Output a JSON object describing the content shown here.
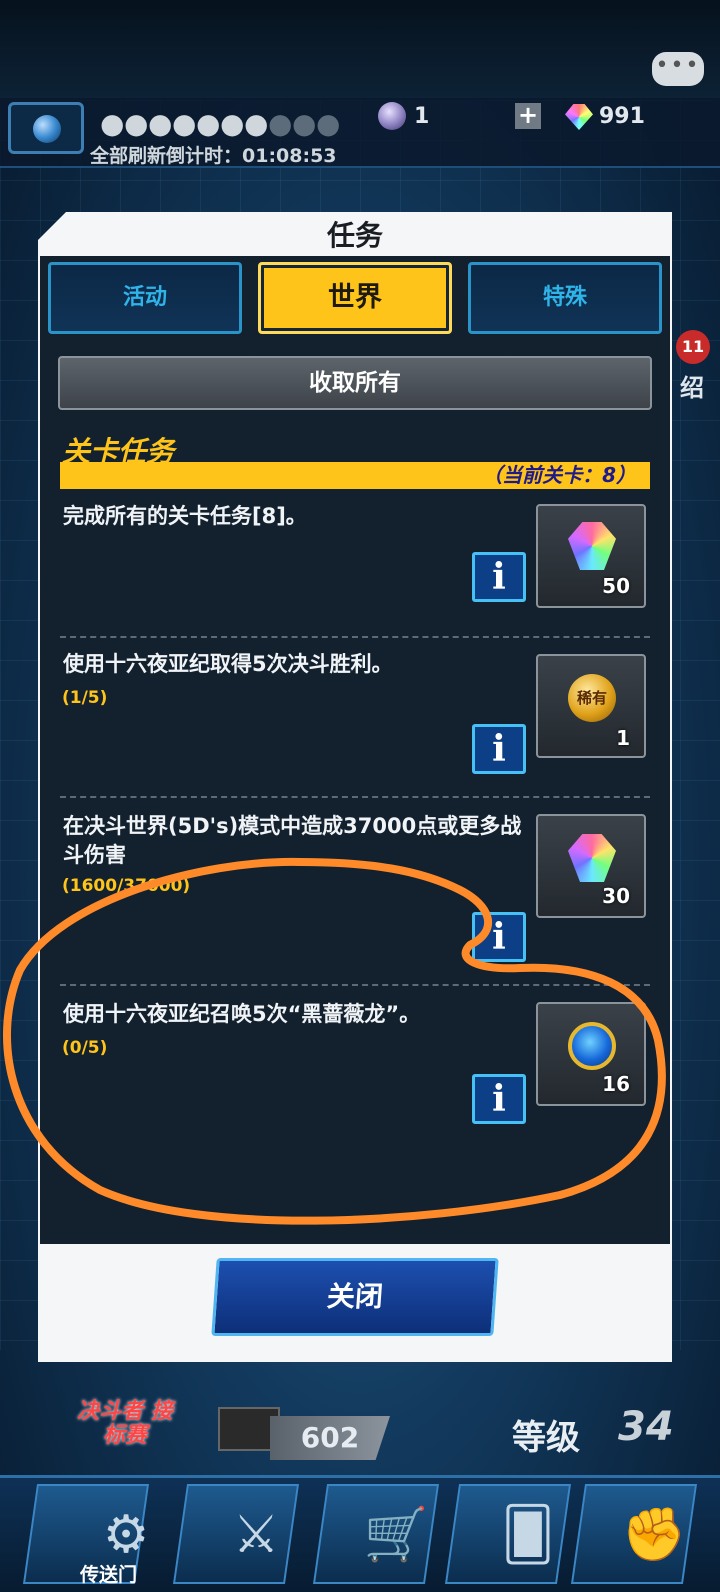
{
  "hud": {
    "refresh_countdown": "全部刷新倒计时：01:08:53",
    "orb_count": "1",
    "gem_count": "991",
    "plus": "+",
    "chat": "•••",
    "side_badge": "11",
    "side_label": "绍"
  },
  "bottom": {
    "logo_text": "决斗者 接标赛",
    "deck_count": "602",
    "level_label": "等级",
    "level_value": "34",
    "portal_label": "传送门"
  },
  "modal": {
    "title": "任务",
    "tabs": [
      {
        "label": "活动"
      },
      {
        "label": "世界"
      },
      {
        "label": "特殊"
      }
    ],
    "active_tab": "世界",
    "collect_all": "收取所有",
    "section_title": "关卡任务",
    "current_stage": "（当前关卡：8）",
    "info_glyph": "i",
    "close_label": "关闭",
    "missions": [
      {
        "text": "完成所有的关卡任务[8]。",
        "progress": "",
        "reward_icon": "rainbow-gem-icon",
        "reward_count": "50"
      },
      {
        "text": "使用十六夜亚纪取得5次决斗胜利。",
        "progress": "(1/5)",
        "reward_icon": "rare-coin-icon",
        "reward_count": "1",
        "reward_badge": "稀有"
      },
      {
        "text": "在决斗世界(5D's)模式中造成37000点或更多战斗伤害",
        "progress": "(1600/37000)",
        "reward_icon": "rainbow-gem-icon",
        "reward_count": "30"
      },
      {
        "text": "使用十六夜亚纪召唤5次“黑蔷薇龙”。",
        "progress": "(0/5)",
        "reward_icon": "blue-key-icon",
        "reward_count": "16"
      }
    ]
  },
  "colors": {
    "accent_gold": "#ffc41a",
    "tab_blue": "#2fb4ea",
    "annotation_orange": "#ff8a2a"
  }
}
